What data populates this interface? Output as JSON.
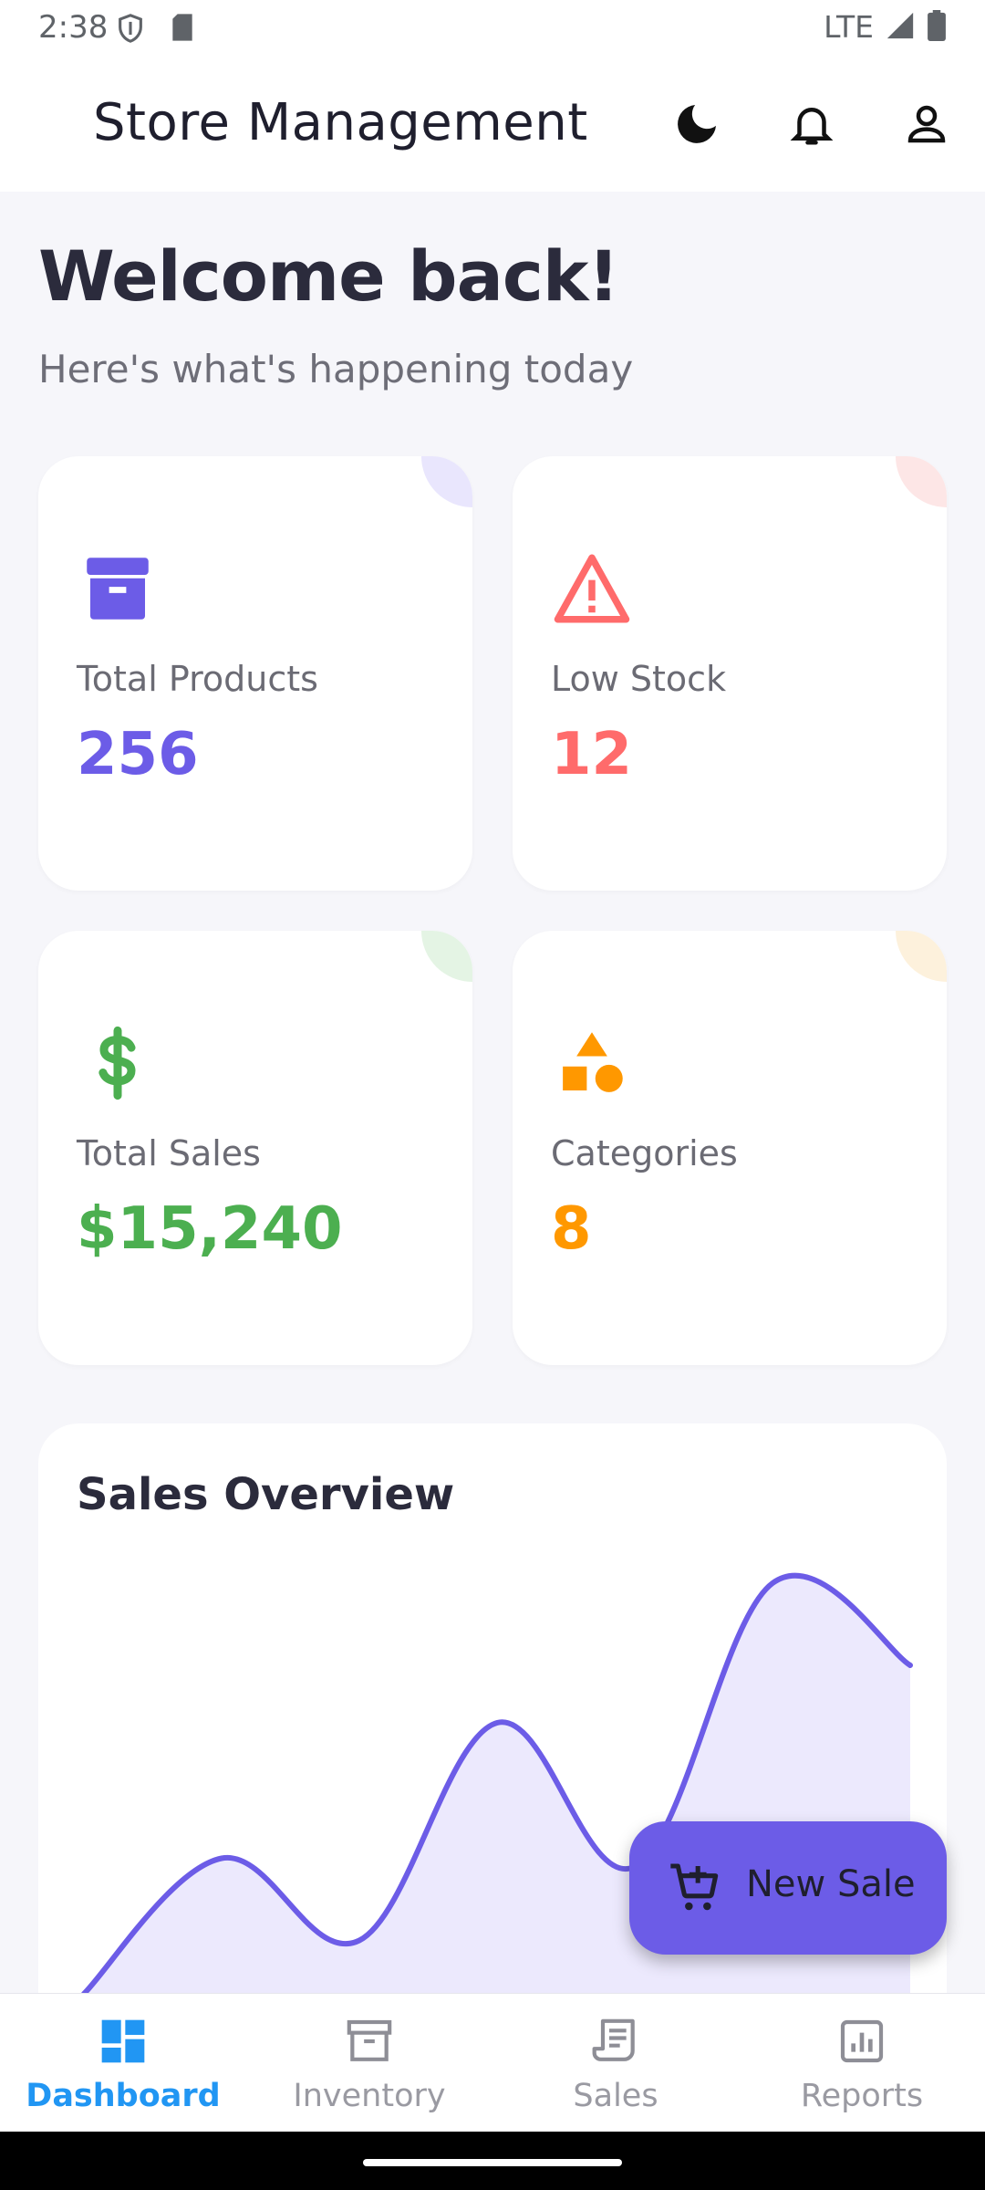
{
  "status_bar": {
    "time": "2:38",
    "network": "LTE"
  },
  "app_bar": {
    "title": "Store Management",
    "actions": [
      "dark-mode-icon",
      "notifications-icon",
      "account-icon"
    ]
  },
  "welcome": {
    "title": "Welcome back!",
    "subtitle": "Here's what's happening today"
  },
  "stats": [
    {
      "label": "Total Products",
      "value": "256",
      "icon": "archive-icon",
      "color": "#6c5ce7",
      "tint": "#e9e6fd"
    },
    {
      "label": "Low Stock",
      "value": "12",
      "icon": "warning-icon",
      "color": "#ff6b6b",
      "tint": "#fde6e6"
    },
    {
      "label": "Total Sales",
      "value": "$15,240",
      "icon": "dollar-icon",
      "color": "#4caf50",
      "tint": "#e4f4e4"
    },
    {
      "label": "Categories",
      "value": "8",
      "icon": "category-icon",
      "color": "#ff9800",
      "tint": "#fdf1dc"
    }
  ],
  "chart": {
    "title": "Sales Overview",
    "chart_data": {
      "type": "area",
      "title": "Sales Overview",
      "xlabel": "",
      "ylabel": "",
      "ylim": [
        0,
        100
      ],
      "x": [
        0,
        1,
        2,
        3,
        4,
        5,
        6
      ],
      "series": [
        {
          "values": [
            0,
            33,
            13,
            66,
            31,
            100,
            80
          ]
        }
      ],
      "grid": false,
      "color": "#6c5ce7",
      "fill": "#ece9fd"
    }
  },
  "fab": {
    "label": "New Sale",
    "icon": "add-cart-icon"
  },
  "bottom_nav": {
    "items": [
      {
        "label": "Dashboard",
        "icon": "dashboard-icon",
        "active": true
      },
      {
        "label": "Inventory",
        "icon": "inventory-icon",
        "active": false
      },
      {
        "label": "Sales",
        "icon": "receipt-icon",
        "active": false
      },
      {
        "label": "Reports",
        "icon": "reports-icon",
        "active": false
      }
    ],
    "active_color": "#2196f3"
  }
}
